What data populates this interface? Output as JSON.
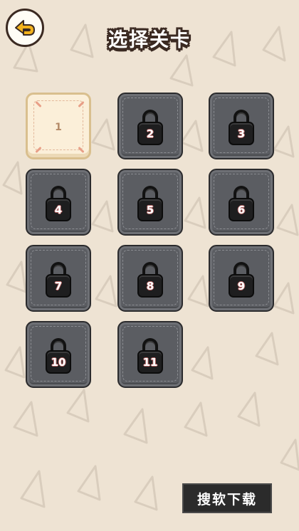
{
  "header": {
    "title": "选择关卡",
    "back_icon": "back-arrow-icon"
  },
  "levels": [
    {
      "number": "1",
      "locked": false
    },
    {
      "number": "2",
      "locked": true
    },
    {
      "number": "3",
      "locked": true
    },
    {
      "number": "4",
      "locked": true
    },
    {
      "number": "5",
      "locked": true
    },
    {
      "number": "6",
      "locked": true
    },
    {
      "number": "7",
      "locked": true
    },
    {
      "number": "8",
      "locked": true
    },
    {
      "number": "9",
      "locked": true
    },
    {
      "number": "10",
      "locked": true
    },
    {
      "number": "11",
      "locked": true
    }
  ],
  "footer": {
    "download_label": "搜软下载"
  },
  "colors": {
    "background": "#eee3d3",
    "locked_tile": "#5b5d62",
    "unlocked_tile": "#fbefd9",
    "back_arrow": "#f3b21c"
  }
}
